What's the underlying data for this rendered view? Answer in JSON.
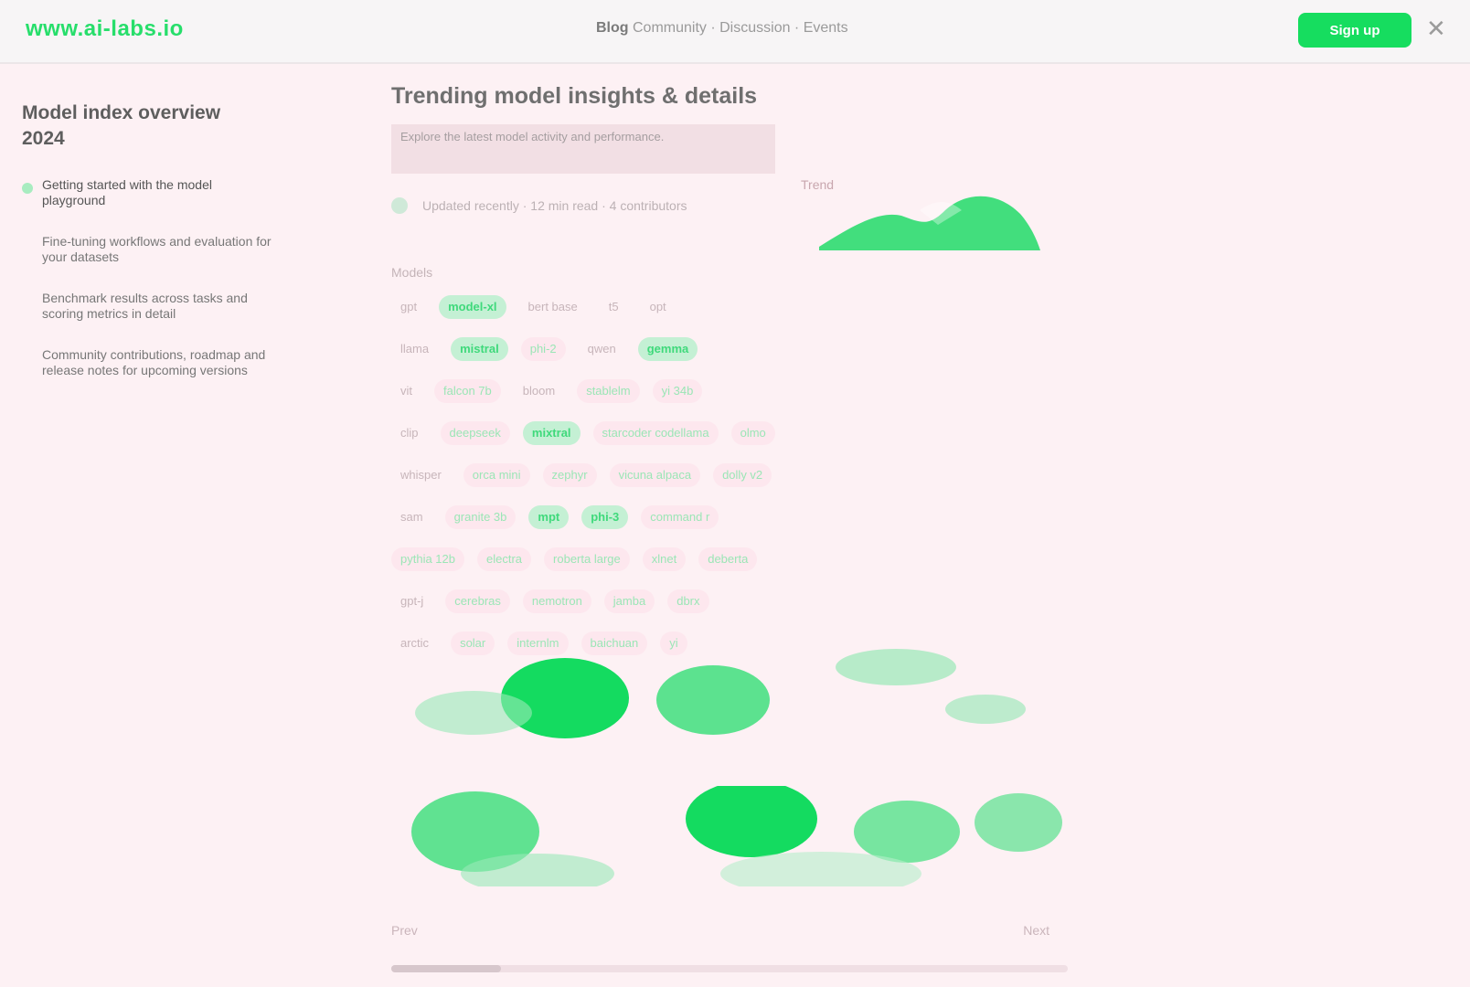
{
  "topbar": {
    "brand": "www.ai-labs.io",
    "center_prefix": "Blog",
    "center_text": "Community · Discussion · Events",
    "action_label": "Sign up",
    "close_icon": "close-icon"
  },
  "sidebar": {
    "title": "Model index overview 2024",
    "items": [
      {
        "label": "Getting started with the model playground",
        "active": true
      },
      {
        "label": "Fine-tuning workflows and evaluation for your datasets",
        "active": false
      },
      {
        "label": "Benchmark results across tasks and scoring metrics in detail",
        "active": false
      },
      {
        "label": "Community contributions, roadmap and release notes for upcoming versions",
        "active": false
      }
    ]
  },
  "main": {
    "title": "Trending model insights & details",
    "description": "Explore the latest model activity and performance.",
    "meta": "Updated recently · 12 min read · 4 contributors",
    "preview_label": "Trend",
    "grid_label": "Models",
    "rows": [
      [
        [
          "gpt",
          "p0"
        ],
        [
          "model-xl",
          "p2"
        ],
        [
          "bert base",
          "p0"
        ],
        [
          "t5",
          "p0"
        ],
        [
          "opt",
          "p0"
        ]
      ],
      [
        [
          "llama",
          "p0"
        ],
        [
          "mistral",
          "p2"
        ],
        [
          "phi-2",
          "p1"
        ],
        [
          "qwen",
          "p0"
        ],
        [
          "gemma",
          "p2"
        ]
      ],
      [
        [
          "vit",
          "p0"
        ],
        [
          "falcon 7b",
          "p1"
        ],
        [
          "bloom",
          "p0"
        ],
        [
          "stablelm",
          "p1"
        ],
        [
          "yi 34b",
          "p1"
        ]
      ],
      [
        [
          "clip",
          "p0"
        ],
        [
          "deepseek",
          "p1"
        ],
        [
          "mixtral",
          "p2"
        ],
        [
          "starcoder codellama",
          "p1"
        ],
        [
          "olmo",
          "p1"
        ]
      ],
      [
        [
          "whisper",
          "p0"
        ],
        [
          "orca mini",
          "p1"
        ],
        [
          "zephyr",
          "p1"
        ],
        [
          "vicuna alpaca",
          "p1"
        ],
        [
          "dolly v2",
          "p1"
        ]
      ],
      [
        [
          "sam",
          "p0"
        ],
        [
          "granite 3b",
          "p1"
        ],
        [
          "mpt",
          "p2"
        ],
        [
          "phi-3",
          "p2"
        ],
        [
          "command r",
          "p1"
        ]
      ],
      [
        [
          "pythia 12b",
          "p1"
        ],
        [
          "electra",
          "p1"
        ],
        [
          "roberta large",
          "p1"
        ],
        [
          "xlnet",
          "p1"
        ],
        [
          "deberta",
          "p1"
        ]
      ],
      [
        [
          "gpt-j",
          "p0"
        ],
        [
          "cerebras",
          "p1"
        ],
        [
          "nemotron",
          "p1"
        ],
        [
          "jamba",
          "p1"
        ],
        [
          "dbrx",
          "p1"
        ]
      ],
      [
        [
          "arctic",
          "p0"
        ],
        [
          "solar",
          "p1"
        ],
        [
          "internlm",
          "p1"
        ],
        [
          "baichuan",
          "p1"
        ],
        [
          "yi",
          "p1"
        ]
      ]
    ],
    "bottom_left": "Prev",
    "bottom_right": "Next"
  }
}
